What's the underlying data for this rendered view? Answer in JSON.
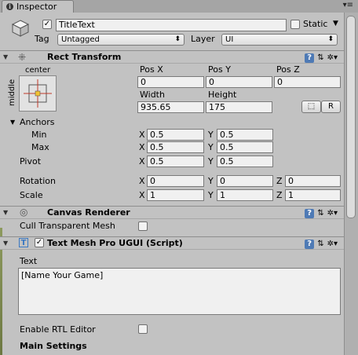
{
  "tab": {
    "label": "Inspector",
    "menu_icon": "menu-icon"
  },
  "object": {
    "active": true,
    "name": "TitleText",
    "static_label": "Static",
    "static": false,
    "tag_label": "Tag",
    "tag_value": "Untagged",
    "layer_label": "Layer",
    "layer_value": "UI"
  },
  "rect_transform": {
    "title": "Rect Transform",
    "anchor_h": "center",
    "anchor_v": "middle",
    "pos_x_label": "Pos X",
    "pos_y_label": "Pos Y",
    "pos_z_label": "Pos Z",
    "pos_x": "0",
    "pos_y": "0",
    "pos_z": "0",
    "width_label": "Width",
    "height_label": "Height",
    "width": "935.65",
    "height": "175",
    "raw_btn": "R",
    "anchors_label": "Anchors",
    "min_label": "Min",
    "max_label": "Max",
    "min_x": "0.5",
    "min_y": "0.5",
    "max_x": "0.5",
    "max_y": "0.5",
    "pivot_label": "Pivot",
    "pivot_x": "0.5",
    "pivot_y": "0.5",
    "rotation_label": "Rotation",
    "rot_x": "0",
    "rot_y": "0",
    "rot_z": "0",
    "scale_label": "Scale",
    "scale_x": "1",
    "scale_y": "1",
    "scale_z": "1",
    "x": "X",
    "y": "Y",
    "z": "Z"
  },
  "canvas_renderer": {
    "title": "Canvas Renderer",
    "cull_label": "Cull Transparent Mesh",
    "cull": false
  },
  "tmp": {
    "title": "Text Mesh Pro UGUI (Script)",
    "enabled": true,
    "text_label": "Text",
    "text_value": "[Name Your Game]",
    "rtl_label": "Enable RTL Editor",
    "rtl": false,
    "main_settings": "Main Settings"
  },
  "colors": {
    "panel": "#c2c2c2",
    "field": "#f0f0f0",
    "help": "#4e7ab5"
  }
}
